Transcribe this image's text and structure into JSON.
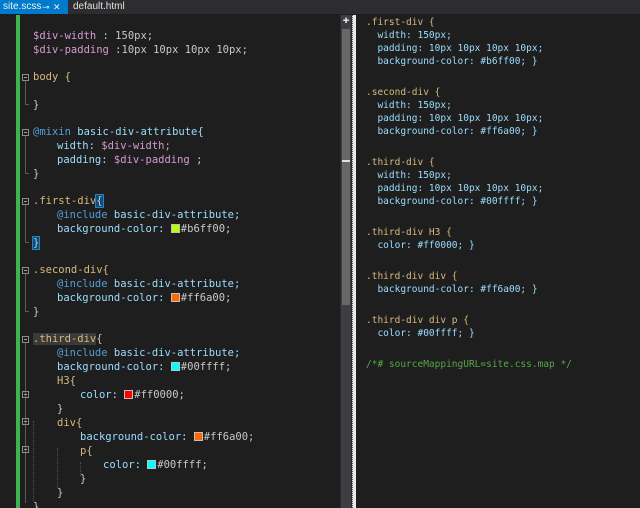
{
  "tabs": [
    {
      "label": "site.scss",
      "active": true,
      "pin": "pin-icon",
      "close": "close-icon"
    },
    {
      "label": "default.html",
      "active": false
    }
  ],
  "colors": {
    "accent": "#007acc",
    "margin_bar": "#3fb34f"
  },
  "scss": {
    "l1_var": "$div-width",
    "l1_rest": " : 150px;",
    "l2_var": "$div-padding",
    "l2_rest": " :10px 10px 10px 10px;",
    "l4": "body {",
    "l6": "}",
    "l8_kw": "@mixin",
    "l8_name": " basic-div-attribute{",
    "l9_prop": "width:",
    "l9_val": " $div-width;",
    "l10_prop": "padding:",
    "l10_val": " $div-padding",
    "l10_end": " ;",
    "l11": "}",
    "l13_sel": ".first-div",
    "l13_brace": "{",
    "l14_kw": "@include",
    "l14_rest": " basic-div-attribute;",
    "l15_prop": "background-color:",
    "l15_val": "#b6ff00;",
    "l16": "}",
    "l18_sel": ".second-div{",
    "l19_kw": "@include",
    "l19_rest": " basic-div-attribute;",
    "l20_prop": "background-color:",
    "l20_val": "#ff6a00;",
    "l21": "}",
    "l23_sel": ".third-div",
    "l23_brace": "{",
    "l24_kw": "@include",
    "l24_rest": " basic-div-attribute;",
    "l25_prop": "background-color:",
    "l25_val": "#00ffff;",
    "l26_sel": "H3{",
    "l27_prop": "color:",
    "l27_val": "#ff0000;",
    "l28": "}",
    "l29_sel": "div{",
    "l30_prop": "background-color:",
    "l30_val": "#ff6a00;",
    "l31_sel": "p{",
    "l32_prop": "color:",
    "l32_val": "#00ffff;",
    "l33": "}",
    "l34": "}",
    "l35": "}"
  },
  "swatches": {
    "first": "#b6ff00",
    "second": "#ff6a00",
    "third": "#00ffff",
    "h3": "#ff0000",
    "div": "#ff6a00",
    "p": "#00ffff"
  },
  "css": {
    "r1": ".first-div {",
    "r2": "  width: 150px;",
    "r3": "  padding: 10px 10px 10px 10px;",
    "r4": "  background-color: #b6ff00; }",
    "r6": ".second-div {",
    "r7": "  width: 150px;",
    "r8": "  padding: 10px 10px 10px 10px;",
    "r9": "  background-color: #ff6a00; }",
    "r11": ".third-div {",
    "r12": "  width: 150px;",
    "r13": "  padding: 10px 10px 10px 10px;",
    "r14": "  background-color: #00ffff; }",
    "r16": ".third-div H3 {",
    "r17": "  color: #ff0000; }",
    "r19": ".third-div div {",
    "r20": "  background-color: #ff6a00; }",
    "r22": ".third-div div p {",
    "r23": "  color: #00ffff; }",
    "r25": "/*# sourceMappingURL=site.css.map */"
  }
}
